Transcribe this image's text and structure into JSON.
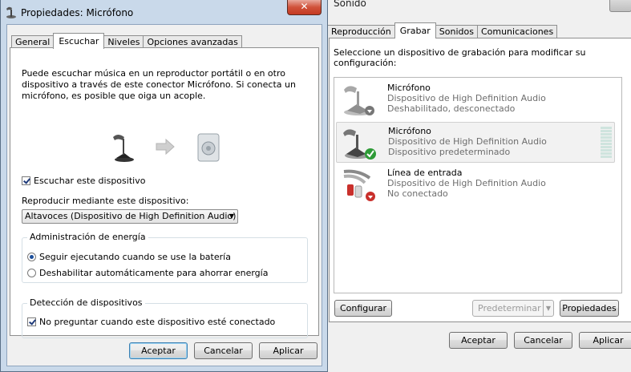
{
  "sound_window": {
    "title": "Sonido",
    "tabs": [
      {
        "label": "Reproducción"
      },
      {
        "label": "Grabar"
      },
      {
        "label": "Sonidos"
      },
      {
        "label": "Comunicaciones"
      }
    ],
    "instruction": "Seleccione un dispositivo de grabación para modificar su configuración:",
    "devices": [
      {
        "name": "Micrófono",
        "description": "Dispositivo de High Definition Audio",
        "status": "Deshabilitado, desconectado",
        "icon": "microphone-disabled-icon"
      },
      {
        "name": "Micrófono",
        "description": "Dispositivo de High Definition Audio",
        "status": "Dispositivo predeterminado",
        "icon": "microphone-default-icon"
      },
      {
        "name": "Línea de entrada",
        "description": "Dispositivo de High Definition Audio",
        "status": "No conectado",
        "icon": "line-in-icon"
      }
    ],
    "buttons": {
      "configure": "Configurar",
      "set_default": "Predeterminar",
      "properties": "Propiedades",
      "ok": "Aceptar",
      "cancel": "Cancelar",
      "apply": "Aplicar"
    }
  },
  "properties_window": {
    "title": "Propiedades: Micrófono",
    "close_glyph": "✕",
    "tabs": [
      {
        "label": "General"
      },
      {
        "label": "Escuchar"
      },
      {
        "label": "Niveles"
      },
      {
        "label": "Opciones avanzadas"
      }
    ],
    "description": "Puede escuchar música en un reproductor portátil o en otro dispositivo a través de este conector Micrófono. Si conecta un micrófono, es posible que oiga un acople.",
    "listen_checkbox": {
      "label": "Escuchar este dispositivo",
      "checked": true
    },
    "playback_label": "Reproducir mediante este dispositivo:",
    "playback_select": "Altavoces (Dispositivo de High Definition Audio)",
    "power_group": {
      "title": "Administración de energía",
      "options": [
        {
          "label": "Seguir ejecutando cuando se use la batería",
          "selected": true
        },
        {
          "label": "Deshabilitar automáticamente para ahorrar energía",
          "selected": false
        }
      ]
    },
    "detection_group": {
      "title": "Detección de dispositivos",
      "checkbox": {
        "label": "No preguntar cuando este dispositivo esté conectado",
        "checked": true
      }
    },
    "buttons": {
      "ok": "Aceptar",
      "cancel": "Cancelar",
      "apply": "Aplicar"
    }
  },
  "colors": {
    "accent": "#3c7fb1",
    "window_frame": "#c9d9ea",
    "close_red": "#c43a22",
    "status_gray": "#6d6d6d"
  }
}
